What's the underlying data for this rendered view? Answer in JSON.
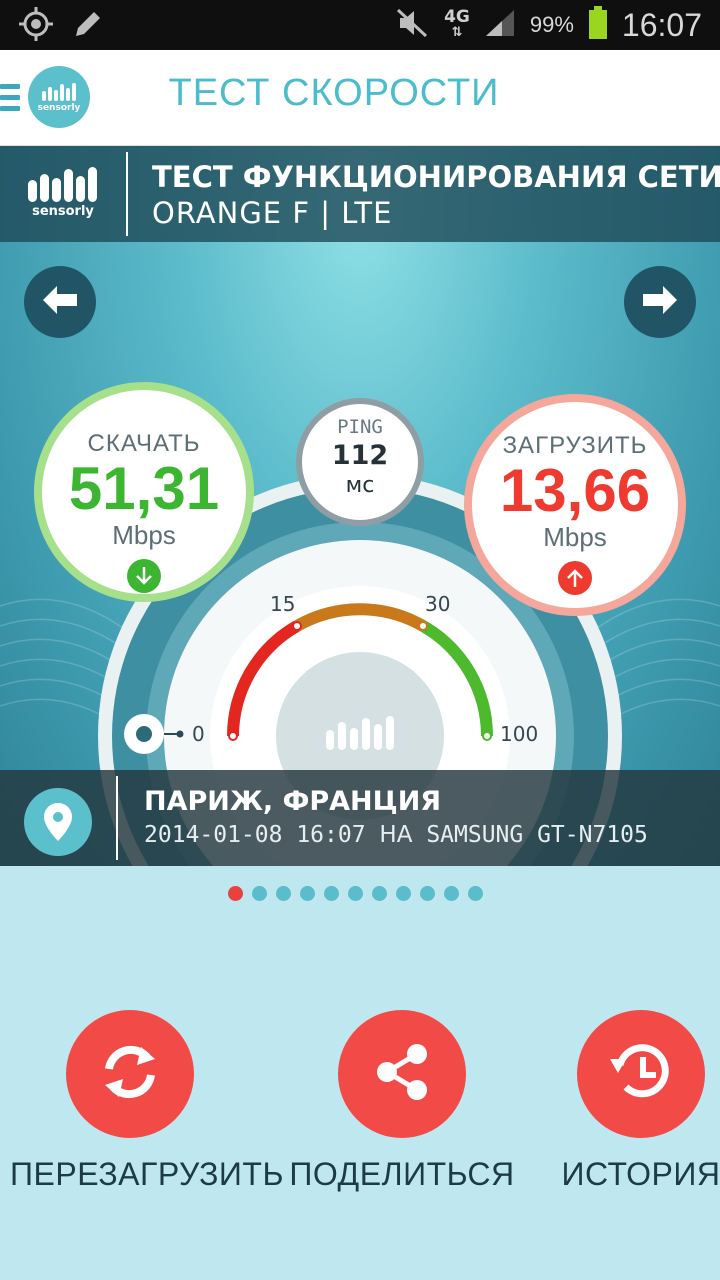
{
  "status_bar": {
    "icons": [
      "gps-icon",
      "edit-icon",
      "mute-icon",
      "network-4g-icon",
      "signal-icon",
      "battery-icon"
    ],
    "network": "4G",
    "battery": "99%",
    "time": "16:07"
  },
  "app_bar": {
    "title": "ТЕСТ СКОРОСТИ",
    "logo_text": "sensorly"
  },
  "test_header": {
    "logo_text": "sensorly",
    "title": "ТЕСТ ФУНКЦИОНИРОВАНИЯ СЕТИ...",
    "subtitle": "ORANGE F | LTE"
  },
  "download": {
    "label": "СКАЧАТЬ",
    "value": "51,31",
    "unit": "Mbps",
    "color": "#3cb531"
  },
  "upload": {
    "label": "ЗАГРУЗИТЬ",
    "value": "13,66",
    "unit": "Mbps",
    "color": "#ee3a2f"
  },
  "ping": {
    "label": "PING",
    "value": "112",
    "unit": "мс"
  },
  "gauge": {
    "ticks": [
      "0",
      "15",
      "30",
      "100"
    ]
  },
  "location": {
    "city": "ПАРИЖ, ФРАНЦИЯ",
    "datetime": "2014-01-08 16:07",
    "on_label": "НА",
    "device": "SAMSUNG GT-N7105"
  },
  "pager": {
    "count": 11,
    "active_index": 0
  },
  "actions": {
    "restart": "ПЕРЕЗАГРУЗИТЬ",
    "share": "ПОДЕЛИТЬСЯ",
    "history": "ИСТОРИЯ"
  },
  "colors": {
    "accent": "#4bbccc",
    "action_red": "#f24a47",
    "download_green": "#3cb531",
    "upload_red": "#ee3a2f"
  }
}
